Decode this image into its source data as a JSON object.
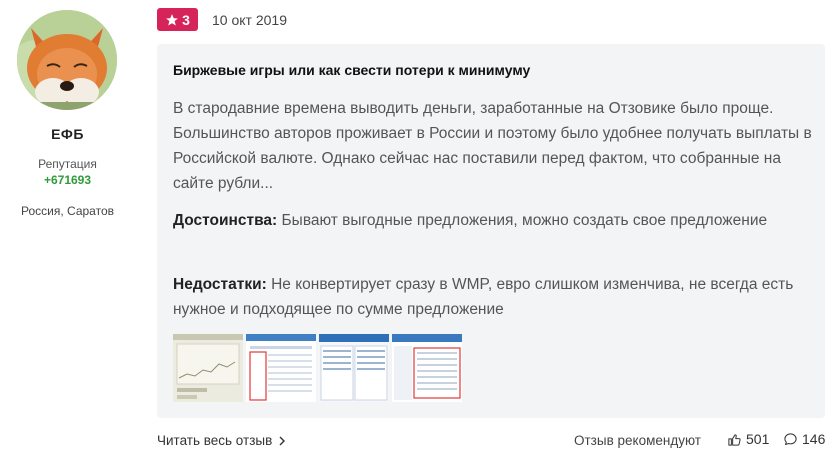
{
  "author": {
    "name": "ЕФБ",
    "reputation_label": "Репутация",
    "reputation_value": "+671693",
    "location": "Россия, Саратов",
    "avatar_icon": "fox-avatar"
  },
  "review": {
    "rating": "3",
    "date": "10 окт 2019",
    "title": "Биржевые игры или как свести потери к минимуму",
    "excerpt": "В стародавние времена выводить деньги, заработанные на Отзовике было проще. Большинство авторов проживает в России и поэтому было удобнее получать выплаты в Российской валюте. Однако сейчас нас поставили перед фактом, что собранные на сайте рубли...",
    "pros_label": "Достоинства:",
    "pros_text": "Бывают выгодные предложения, можно создать свое предложение",
    "cons_label": "Недостатки:",
    "cons_text": "Не конвертирует сразу в WMP, евро слишком изменчива, не всегда есть нужное и подходящее по сумме предложение",
    "thumbnails": [
      "screenshot-1",
      "screenshot-2",
      "screenshot-3",
      "screenshot-4"
    ]
  },
  "footer": {
    "read_more": "Читать весь отзыв",
    "recommend_label": "Отзыв рекомендуют",
    "likes": "501",
    "comments": "146"
  },
  "colors": {
    "badge": "#d6245b",
    "reputation": "#2e9b3a",
    "card_bg": "#f3f4f5"
  }
}
